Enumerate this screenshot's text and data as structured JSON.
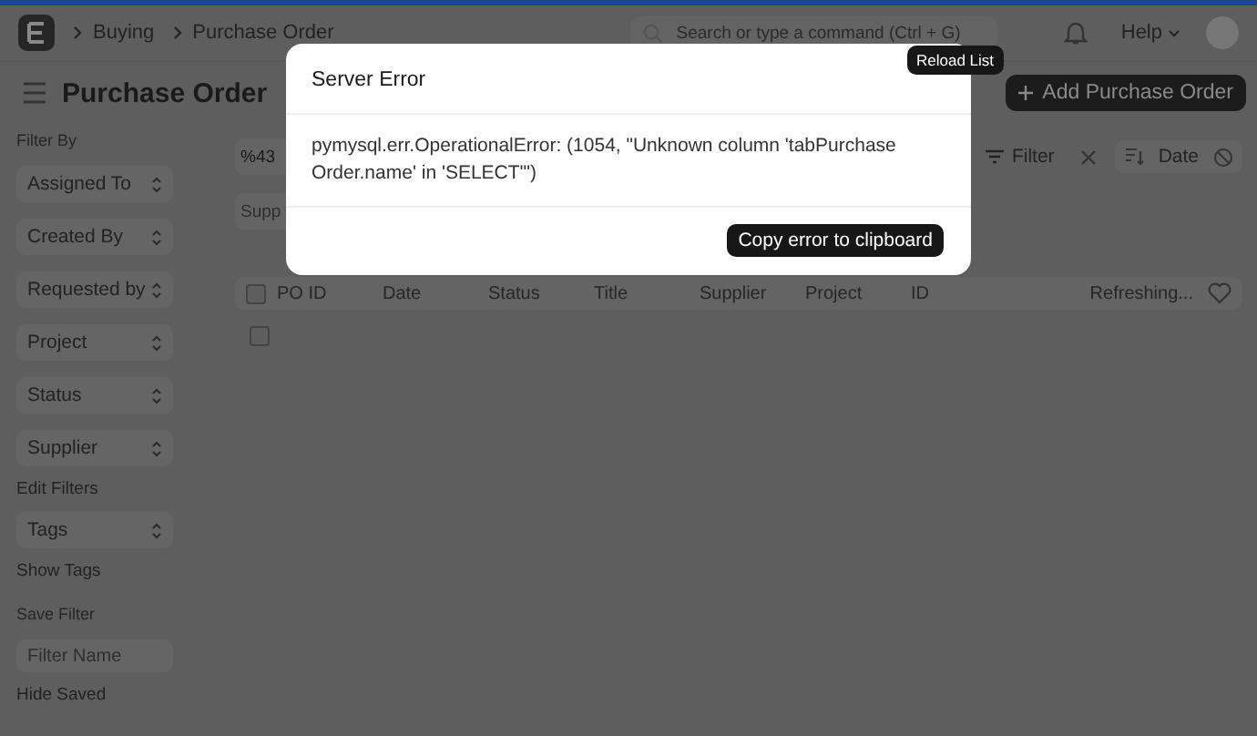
{
  "navbar": {
    "breadcrumbs": [
      "Buying",
      "Purchase Order"
    ],
    "search": {
      "placeholder": "Search or type a command (Ctrl + G)"
    },
    "help": "Help"
  },
  "page": {
    "title": "Purchase Order",
    "add_button": "Add Purchase Order"
  },
  "sidebar": {
    "heading": "Filter By",
    "filters": [
      "Assigned To",
      "Created By",
      "Requested by",
      "Project",
      "Status",
      "Supplier"
    ],
    "edit_filters": "Edit Filters",
    "tags": "Tags",
    "show_tags": "Show Tags",
    "save_filter": "Save Filter",
    "filter_name": {
      "placeholder": "Filter Name"
    },
    "hide_saved": "Hide Saved"
  },
  "list": {
    "id_field": {
      "value": "%43"
    },
    "supplier_field": {
      "placeholder": "Supp"
    },
    "filter_button": "Filter",
    "sort_button": "Date",
    "select_all": {
      "checked": false
    },
    "columns": [
      "PO ID",
      "Date",
      "Status",
      "Title",
      "Supplier",
      "Project",
      "ID"
    ],
    "status": "Refreshing...",
    "rows": [
      {
        "checked": false
      }
    ]
  },
  "dialog": {
    "title": "Server Error",
    "message": "pymysql.err.OperationalError: (1054, \"Unknown column 'tabPurchase Order.name' in 'SELECT'\")",
    "button": "Copy error to clipboard"
  },
  "tooltip": "Reload List"
}
